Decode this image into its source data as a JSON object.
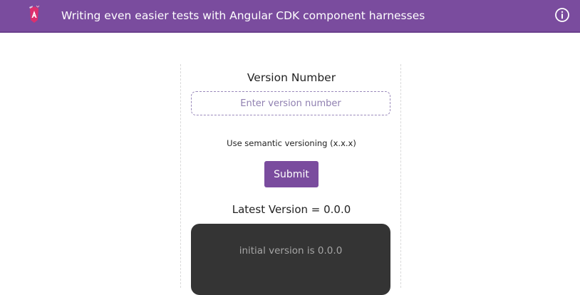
{
  "toolbar": {
    "title": "Writing even easier tests with Angular CDK component harnesses",
    "logo_icon": "angular-logo-icon",
    "info_icon": "info-icon",
    "background_color": "#7a4c9e"
  },
  "form": {
    "label": "Version Number",
    "input_placeholder": "Enter version number",
    "input_value": "",
    "hint": "Use semantic versioning (x.x.x)",
    "submit_label": "Submit"
  },
  "result": {
    "latest_text": "Latest Version = 0.0.0",
    "console_text": "initial version is 0.0.0"
  }
}
